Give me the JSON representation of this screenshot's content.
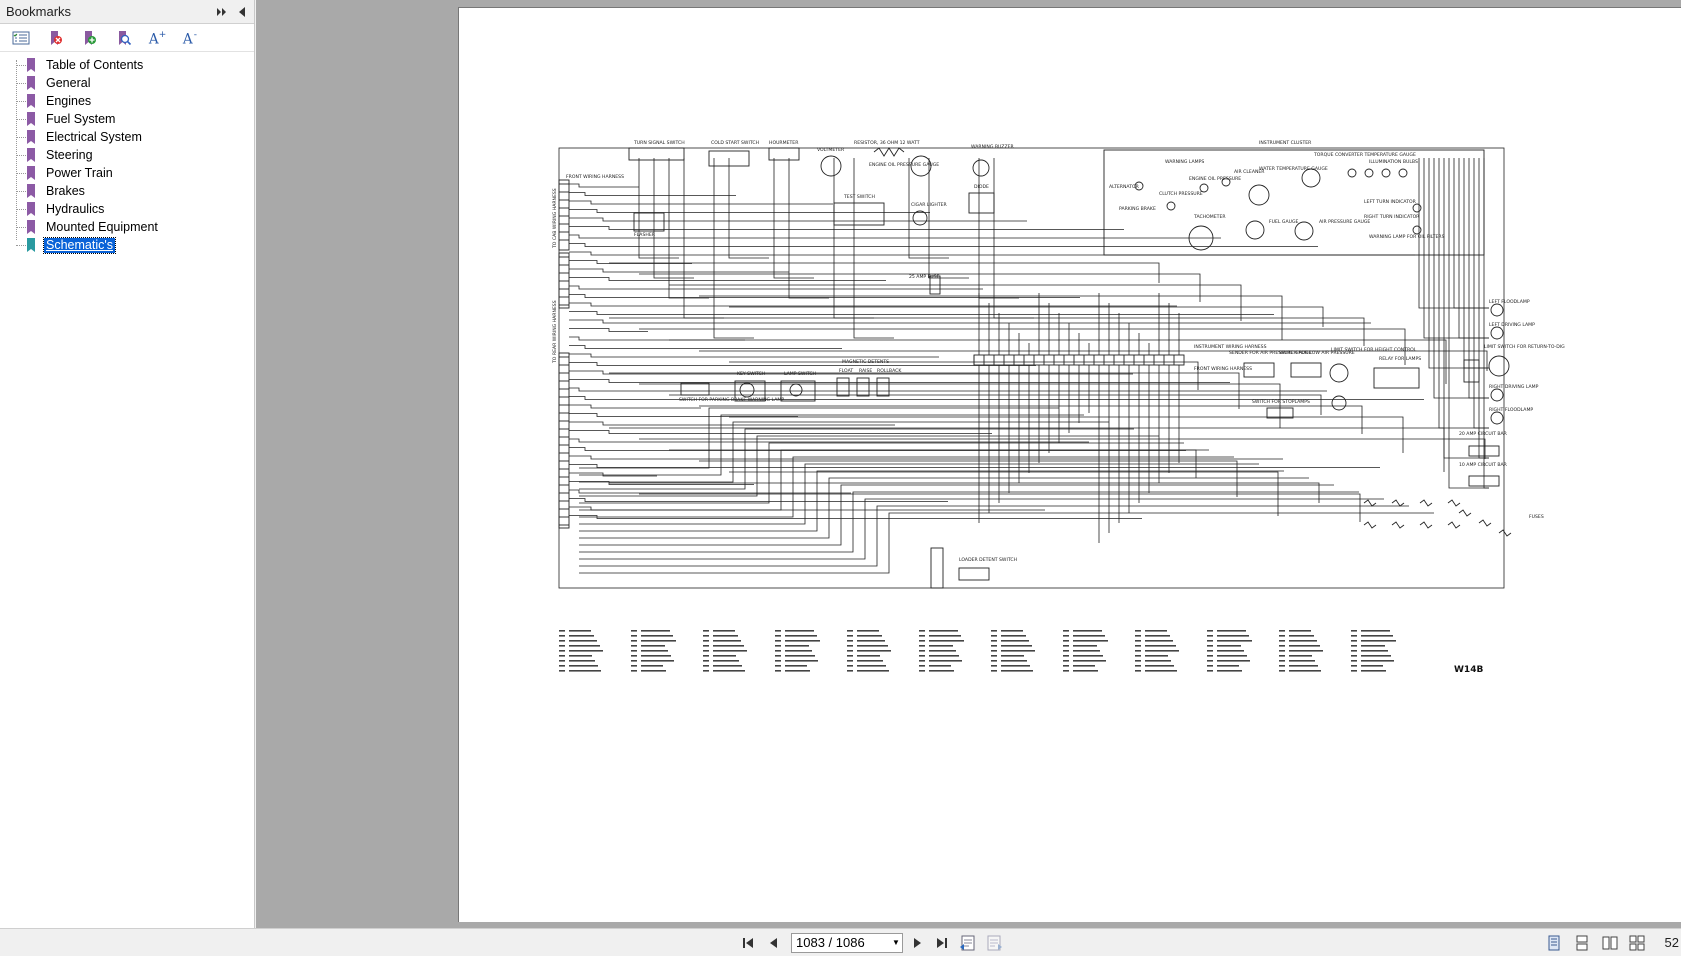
{
  "sidebar": {
    "title": "Bookmarks",
    "toolbar": [
      "options-icon",
      "delete-bookmark-icon",
      "add-bookmark-icon",
      "find-bookmark-icon",
      "enlarge-text-icon",
      "reduce-text-icon"
    ],
    "items": [
      {
        "label": "Table of Contents"
      },
      {
        "label": "General"
      },
      {
        "label": "Engines"
      },
      {
        "label": "Fuel System"
      },
      {
        "label": "Electrical System"
      },
      {
        "label": "Steering"
      },
      {
        "label": "Power Train"
      },
      {
        "label": "Brakes"
      },
      {
        "label": "Hydraulics"
      },
      {
        "label": "Mounted Equipment"
      },
      {
        "label": "Schematic's"
      }
    ],
    "selected_index": 10
  },
  "schematic": {
    "code": "W14B",
    "labels": {
      "turn_signal": "TURN SIGNAL SWITCH",
      "cold_start": "COLD START SWITCH",
      "hourmeter": "HOURMETER",
      "voltmeter": "VOLTMETER",
      "resistor": "RESISTOR, 36 OHM 12 WATT",
      "warning_buzzer": "WARNING BUZZER",
      "instrument_cluster": "INSTRUMENT CLUSTER",
      "front_wiring": "FRONT WIRING HARNESS",
      "flasher": "FLASHER",
      "engine_oil": "ENGINE OIL PRESSURE GAUGE",
      "test_switch": "TEST SWITCH",
      "cigar": "CIGAR LIGHTER",
      "diode": "DIODE",
      "warning_lamps": "WARNING LAMPS",
      "alternator": "ALTERNATOR",
      "parking_brake": "PARKING BRAKE",
      "clutch": "CLUTCH PRESSURE",
      "engine_oil_pressure": "ENGINE OIL PRESSURE",
      "air_cleaner": "AIR CLEANER",
      "water_temp": "WATER TEMPERATURE GAUGE",
      "torque": "TORQUE CONVERTER TEMPERATURE GAUGE",
      "illumination": "ILLUMINATION BULBS",
      "tachometer": "TACHOMETER",
      "fuel_gauge": "FUEL GAUGE",
      "air_pressure": "AIR PRESSURE GAUGE",
      "left_turn": "LEFT TURN INDICATOR",
      "right_turn": "RIGHT TURN INDICATOR",
      "oil_filters": "WARNING LAMP FOR OIL FILTERS",
      "fuse25": "25 AMP FUSE",
      "cab_harness": "TO CAB WIRING HARNESS",
      "rear_harness": "TO REAR WIRING HARNESS",
      "left_flood": "LEFT FLOODLAMP",
      "left_driving": "LEFT DRIVING LAMP",
      "limit_return": "LIMIT SWITCH FOR RETURN-TO-DIG",
      "right_driving": "RIGHT DRIVING LAMP",
      "right_flood": "RIGHT FLOODLAMP",
      "instr_harness": "INSTRUMENT WIRING HARNESS",
      "front_harness2": "FRONT WIRING HARNESS",
      "sender_air": "SENDER FOR AIR PRESSURE GAUGE",
      "switch_low_air": "SWITCH FOR LOW AIR PRESSURE",
      "limit_height": "LIMIT SWITCH FOR HEIGHT CONTROL",
      "relay_lamps": "RELAY FOR LAMPS",
      "stoplamps": "SWITCH FOR STOPLAMPS",
      "park_warn": "SWITCH FOR PARKING BRAKE WARNING LAMP",
      "key_switch": "KEY SWITCH",
      "lamp_switch": "LAMP SWITCH",
      "magnetic": "MAGNETIC DETENTS",
      "float": "FLOAT",
      "raise": "RAISE",
      "rollback": "ROLLBACK",
      "cb20": "20 AMP CIRCUIT BAR",
      "cb10": "10 AMP CIRCUIT BAR",
      "fuses": "FUSES",
      "loader_detent": "LOADER DETENT SWITCH"
    }
  },
  "bottombar": {
    "page_value": "1083 / 1086",
    "zoom": "52"
  }
}
